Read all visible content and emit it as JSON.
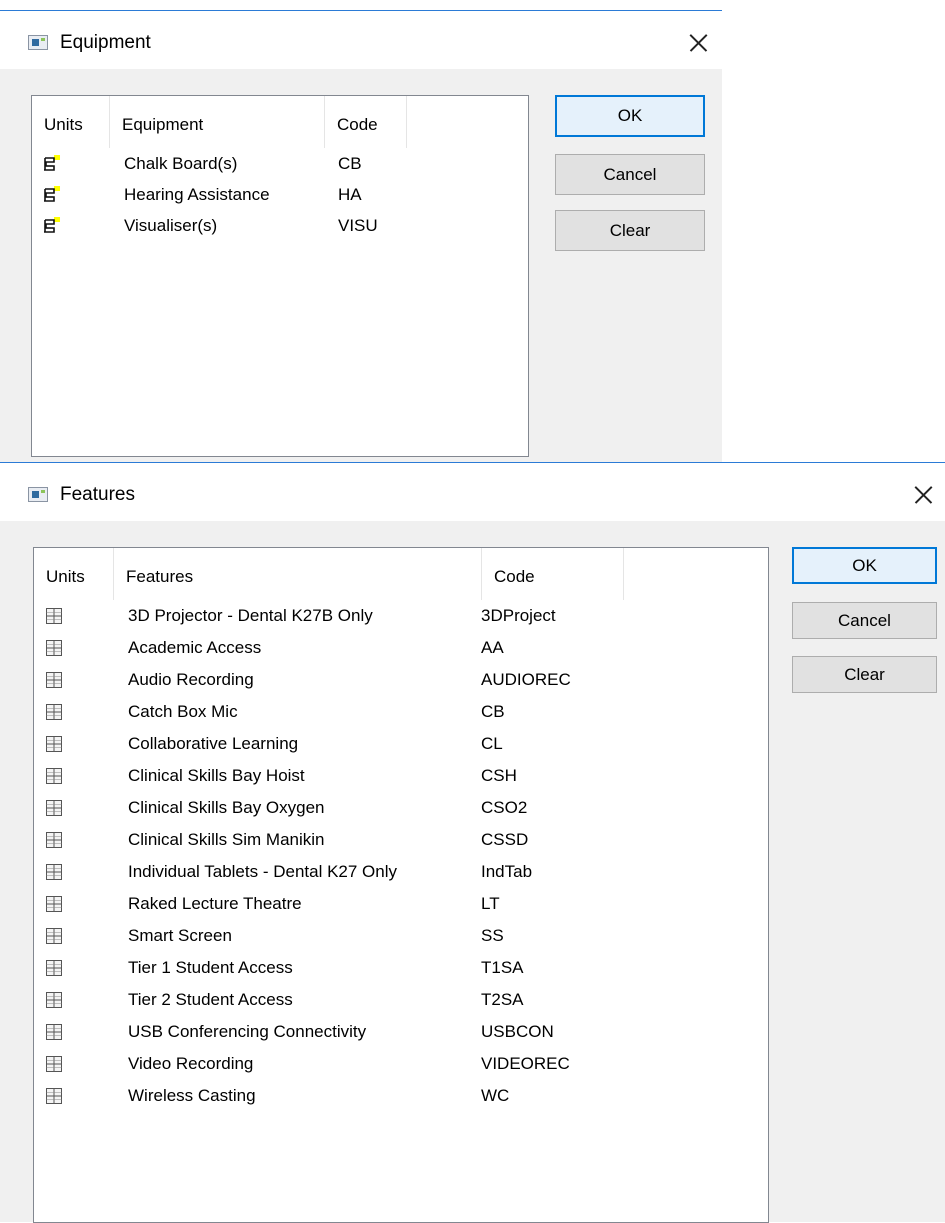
{
  "equipment_dialog": {
    "title": "Equipment",
    "columns": {
      "units": "Units",
      "name": "Equipment",
      "code": "Code"
    },
    "items": [
      {
        "name": "Chalk Board(s)",
        "code": "CB"
      },
      {
        "name": "Hearing Assistance",
        "code": "HA"
      },
      {
        "name": "Visualiser(s)",
        "code": "VISU"
      }
    ],
    "buttons": {
      "ok": "OK",
      "cancel": "Cancel",
      "clear": "Clear"
    },
    "row_icon": "equipment-icon",
    "colors": {
      "accent": "#0078d7",
      "icon_highlight": "#ffff00"
    }
  },
  "features_dialog": {
    "title": "Features",
    "columns": {
      "units": "Units",
      "name": "Features",
      "code": "Code"
    },
    "items": [
      {
        "name": "3D Projector - Dental K27B Only",
        "code": "3DProject"
      },
      {
        "name": "Academic Access",
        "code": "AA"
      },
      {
        "name": "Audio Recording",
        "code": "AUDIOREC"
      },
      {
        "name": "Catch Box Mic",
        "code": "CB"
      },
      {
        "name": "Collaborative Learning",
        "code": "CL"
      },
      {
        "name": "Clinical Skills Bay Hoist",
        "code": "CSH"
      },
      {
        "name": "Clinical Skills Bay Oxygen",
        "code": "CSO2"
      },
      {
        "name": "Clinical Skills Sim Manikin",
        "code": "CSSD"
      },
      {
        "name": "Individual Tablets - Dental K27 Only",
        "code": "IndTab"
      },
      {
        "name": "Raked Lecture Theatre",
        "code": "LT"
      },
      {
        "name": "Smart Screen",
        "code": "SS"
      },
      {
        "name": "Tier 1 Student Access",
        "code": "T1SA"
      },
      {
        "name": "Tier 2 Student Access",
        "code": "T2SA"
      },
      {
        "name": "USB Conferencing Connectivity",
        "code": "USBCON"
      },
      {
        "name": "Video Recording",
        "code": "VIDEOREC"
      },
      {
        "name": "Wireless Casting",
        "code": "WC"
      }
    ],
    "buttons": {
      "ok": "OK",
      "cancel": "Cancel",
      "clear": "Clear"
    },
    "row_icon": "feature-grid-icon",
    "colors": {
      "accent": "#0078d7"
    }
  }
}
